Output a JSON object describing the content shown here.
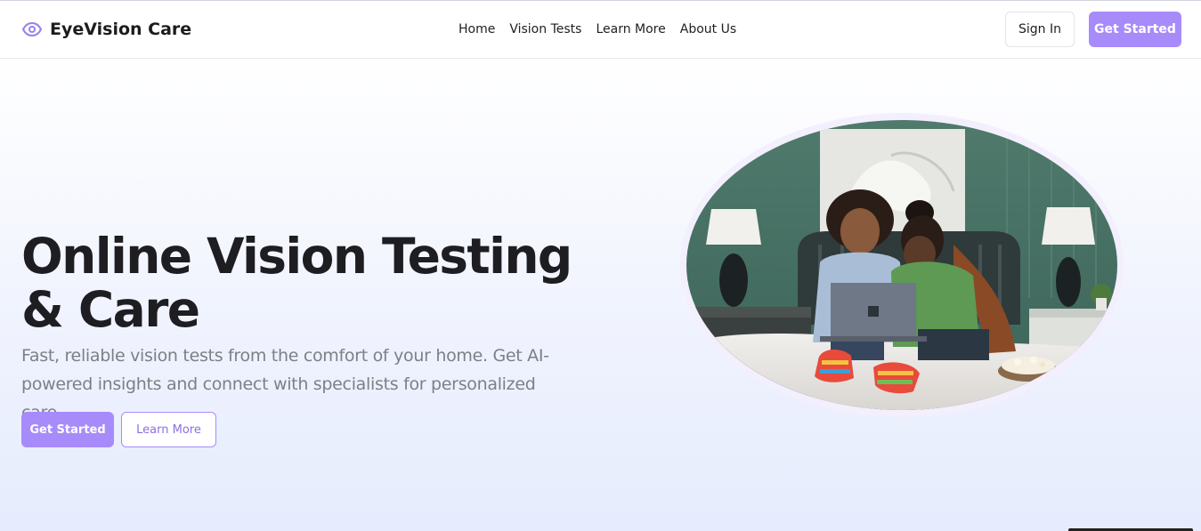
{
  "header": {
    "brand": "EyeVision Care",
    "nav": [
      "Home",
      "Vision Tests",
      "Learn More",
      "About Us"
    ],
    "sign_in": "Sign In",
    "get_started": "Get Started"
  },
  "hero": {
    "title": "Online Vision Testing & Care",
    "subtitle": "Fast, reliable vision tests from the comfort of your home. Get AI-powered insights and connect with specialists for personalized care.",
    "primary_button": "Get Started",
    "secondary_button": "Learn More",
    "image_icon": "two-people-with-laptop-photo"
  },
  "colors": {
    "accent": "#a78bfa",
    "text_dark": "#1d1d22",
    "text_muted": "#7d7f87"
  }
}
